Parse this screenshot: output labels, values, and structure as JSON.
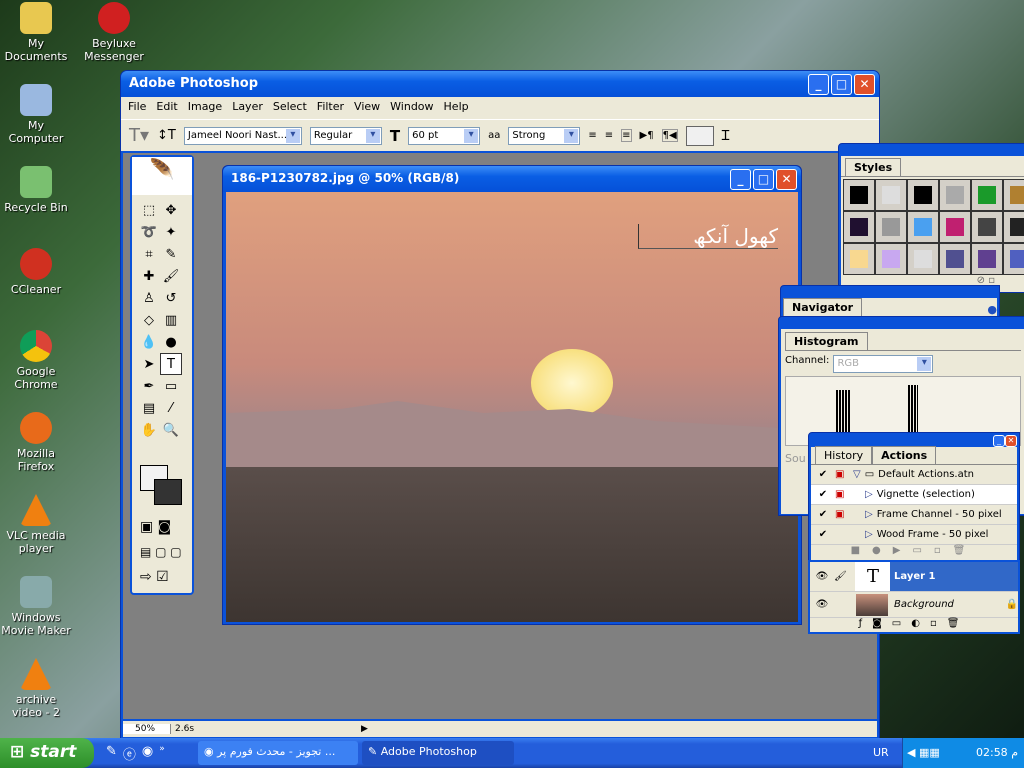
{
  "desktop": {
    "icons": [
      "My Documents",
      "Beyluxe Messenger",
      "My Computer",
      "Recycle Bin",
      "CCleaner",
      "Google Chrome",
      "Mozilla Firefox",
      "VLC media player",
      "Windows Movie Maker",
      "archive video - 2"
    ]
  },
  "app": {
    "title": "Adobe Photoshop",
    "menu": [
      "File",
      "Edit",
      "Image",
      "Layer",
      "Select",
      "Filter",
      "View",
      "Window",
      "Help"
    ],
    "options": {
      "font": "Jameel Noori Nast...",
      "style": "Regular",
      "size": "60 pt",
      "antialias": "Strong"
    }
  },
  "document": {
    "title": "186-P1230782.jpg @ 50% (RGB/8)",
    "text_layer": "کھول آنکھ"
  },
  "status": {
    "zoom": "50%",
    "info": "2.6s"
  },
  "styles_panel": {
    "tab": "Styles",
    "colors": [
      "#000",
      "#ddd",
      "#000",
      "#aaa",
      "#1a9a2a",
      "#b08030",
      "#201030",
      "#999",
      "#4aa0f0",
      "#c02070",
      "#444",
      "#222",
      "#f8d890",
      "#c8a8f0",
      "#ddd",
      "#505090",
      "#604090",
      "#5060c0"
    ]
  },
  "navigator_panel": {
    "tab": "Navigator"
  },
  "histogram_panel": {
    "tab": "Histogram",
    "channel_label": "Channel:",
    "channel": "RGB",
    "source": "Sou"
  },
  "actions_panel": {
    "tabs": [
      "History",
      "Actions"
    ],
    "items": [
      "Default Actions.atn",
      "Vignette (selection)",
      "Frame Channel - 50 pixel",
      "Wood Frame - 50 pixel"
    ]
  },
  "layers_panel": {
    "layers": [
      "Layer 1",
      "Background"
    ]
  },
  "taskbar": {
    "start": "start",
    "tasks": [
      "تجویز - محدث فورم پر ...",
      "Adobe Photoshop"
    ],
    "lang": "UR",
    "clock": "02:58 م"
  }
}
